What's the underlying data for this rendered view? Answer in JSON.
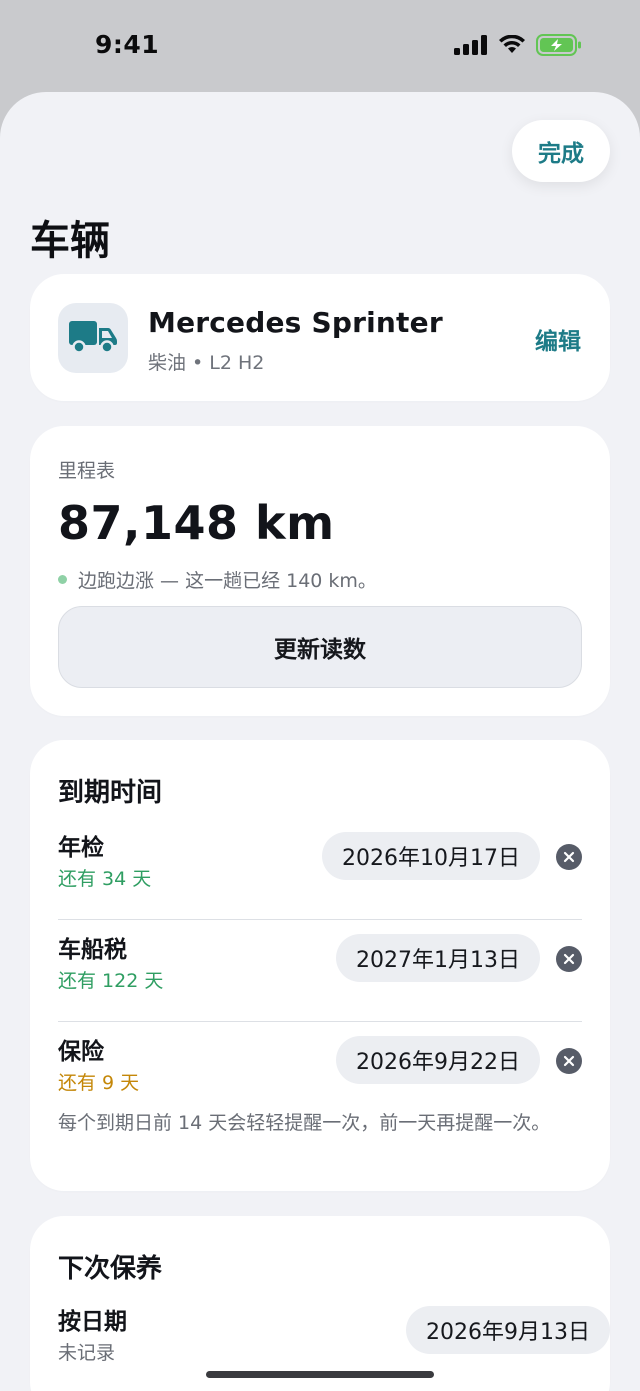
{
  "status_bar": {
    "time": "9:41"
  },
  "header": {
    "done_label": "完成",
    "title": "车辆"
  },
  "vehicle": {
    "icon": "truck-icon",
    "name": "Mercedes Sprinter",
    "subtitle": "柴油 • L2 H2",
    "edit_label": "编辑"
  },
  "odometer": {
    "label": "里程表",
    "value": "87,148 km",
    "status": "边跑边涨 — 这一趟已经 140 km。",
    "update_label": "更新读数"
  },
  "due": {
    "title": "到期时间",
    "items": [
      {
        "name": "年检",
        "remaining": "还有 34 天",
        "date": "2026年10月17日"
      },
      {
        "name": "车船税",
        "remaining": "还有 122 天",
        "date": "2027年1月13日"
      },
      {
        "name": "保险",
        "remaining": "还有 9 天",
        "date": "2026年9月22日"
      }
    ],
    "note": "每个到期日前 14 天会轻轻提醒一次，前一天再提醒一次。"
  },
  "maintenance": {
    "title": "下次保养",
    "by_date_label": "按日期",
    "by_date_status": "未记录",
    "by_date_value": "2026年9月13日"
  },
  "colors": {
    "accent": "#1d7b87",
    "ok": "#2f9e62",
    "warning": "#c48708"
  }
}
